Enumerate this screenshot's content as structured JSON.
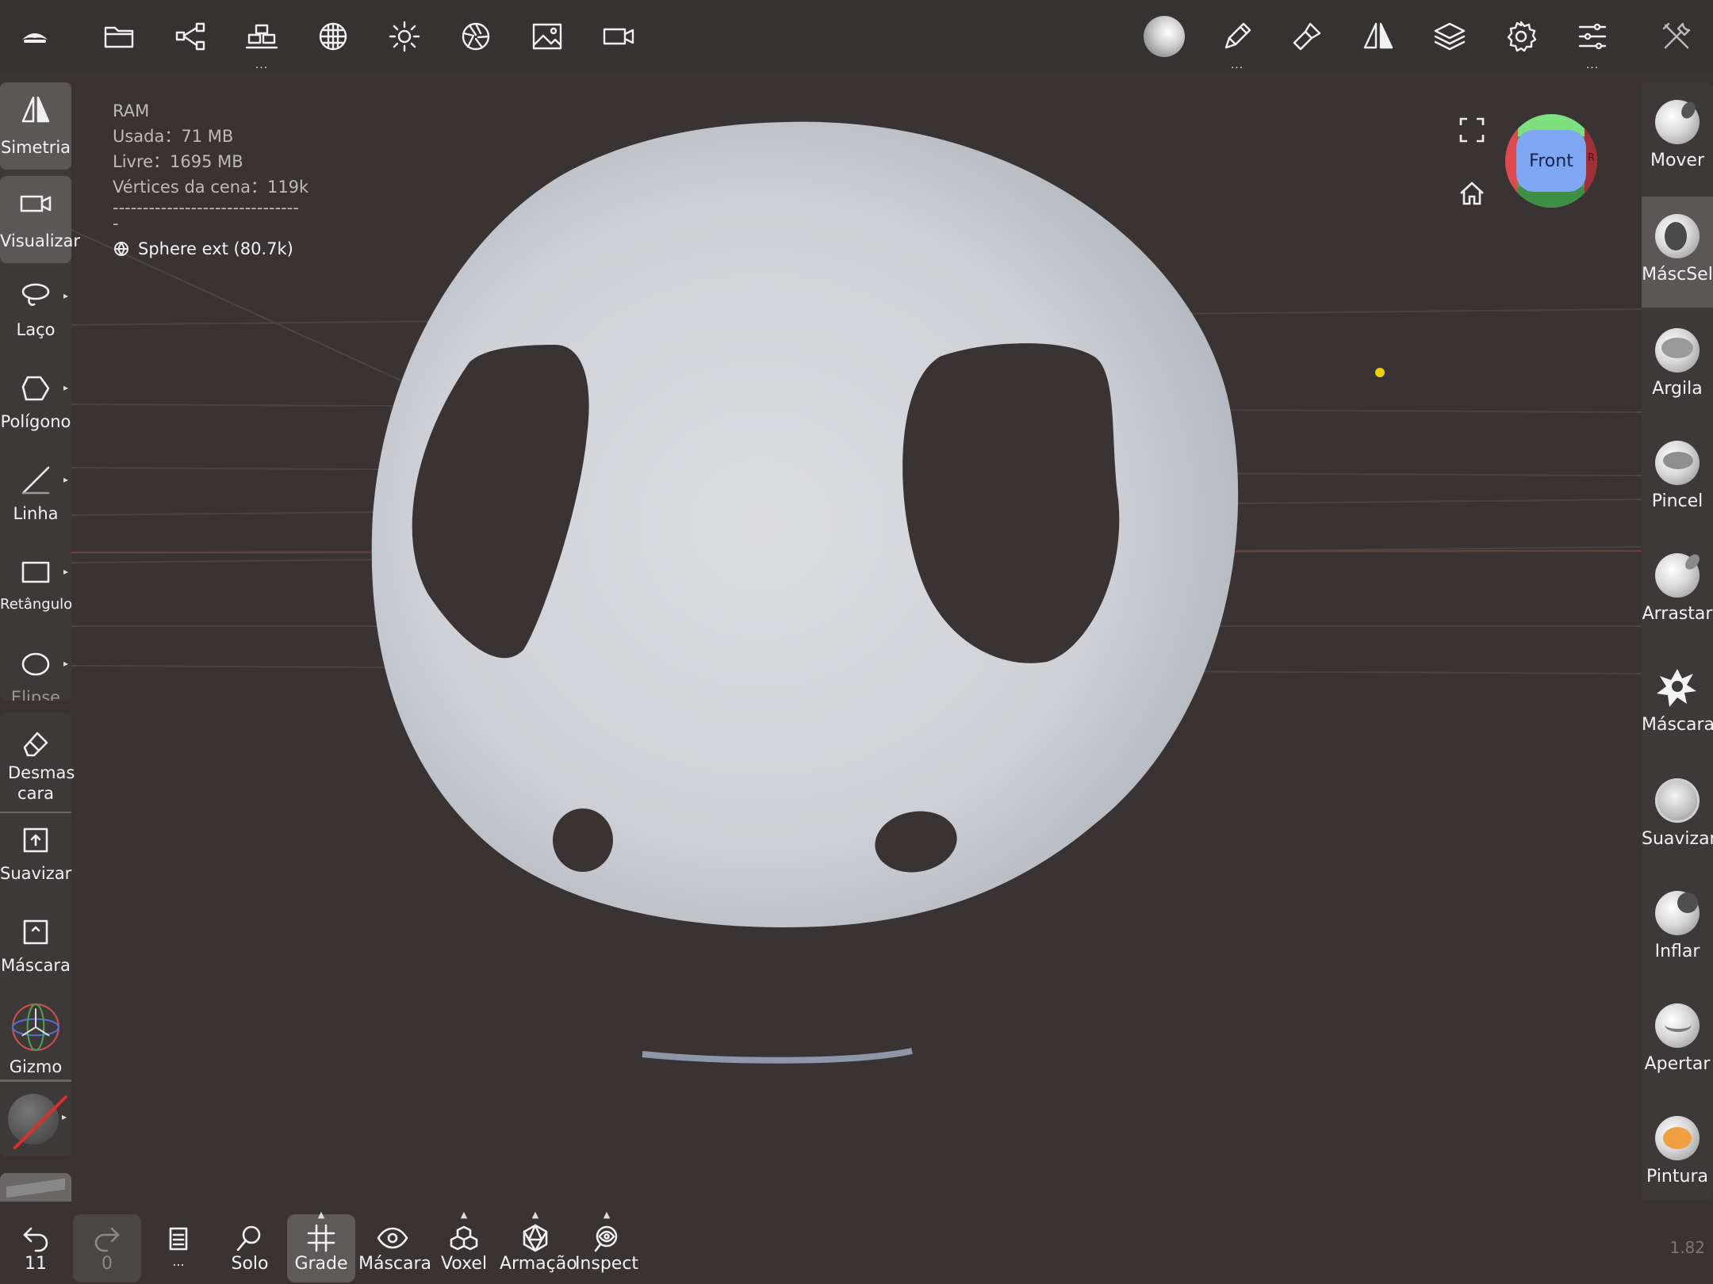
{
  "colors": {
    "background": "#393433",
    "toolbar": "#363232",
    "active": "#5b5757",
    "mesh": "#d2d4d8"
  },
  "topbar": {
    "icons": [
      "app-logo-icon",
      "folder-icon",
      "scene-graph-icon",
      "scene-objects-icon",
      "matcap-icon",
      "light-icon",
      "post-process-icon",
      "background-image-icon",
      "camera-icon"
    ],
    "right_icons": [
      "material-sphere-icon",
      "brush-pencil-icon",
      "paint-brush-icon",
      "symmetry-icon",
      "layers-icon",
      "settings-icon",
      "tool-settings-icon",
      "tools-icon"
    ],
    "dots": "..."
  },
  "info": {
    "ram": "RAM",
    "used": "Usada：71 MB",
    "free": "Livre：1695 MB",
    "vertices": "Vértices da cena：119k",
    "divider": "--------------------------------",
    "object": "Sphere ext (80.7k)"
  },
  "gizmo": {
    "label": "Front",
    "side": "R"
  },
  "left_tools": [
    {
      "label": "Simetria"
    },
    {
      "label": "Visualizar"
    },
    {
      "label": "Laço"
    },
    {
      "label": "Polígono"
    },
    {
      "label": "Linha"
    },
    {
      "label": "Retângulo"
    },
    {
      "label": "Elipse"
    },
    {
      "label": "Desmas cara"
    },
    {
      "label": "Suavizar"
    },
    {
      "label": "Máscara"
    },
    {
      "label": "Gizmo"
    }
  ],
  "right_tools": [
    {
      "label": "Mover"
    },
    {
      "label": "MáscSel"
    },
    {
      "label": "Argila"
    },
    {
      "label": "Pincel"
    },
    {
      "label": "Arrastar"
    },
    {
      "label": "Máscara"
    },
    {
      "label": "Suavizar"
    },
    {
      "label": "Inflar"
    },
    {
      "label": "Apertar"
    },
    {
      "label": "Pintura"
    }
  ],
  "bottom": {
    "undo_count": "11",
    "redo_count": "0",
    "doc_dots": "...",
    "items": [
      {
        "label": "Solo"
      },
      {
        "label": "Grade"
      },
      {
        "label": "Máscara"
      },
      {
        "label": "Voxel"
      },
      {
        "label": "Armação"
      },
      {
        "label": "Inspect"
      }
    ]
  },
  "version": "1.82"
}
